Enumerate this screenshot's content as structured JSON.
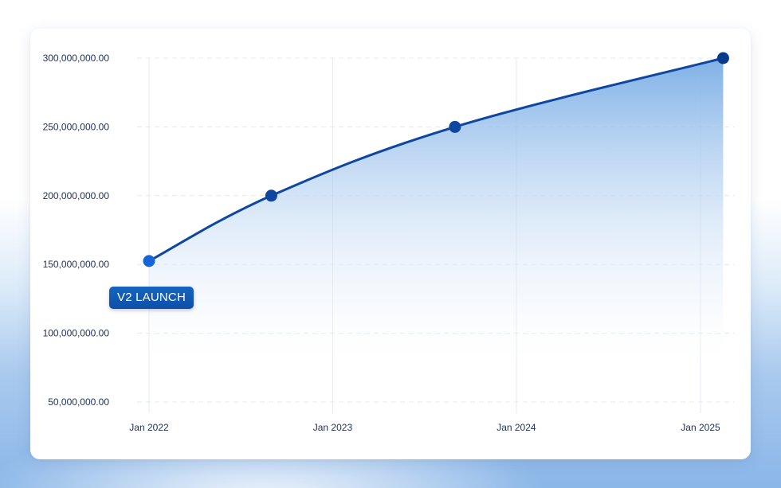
{
  "chart_data": {
    "type": "area",
    "x_type": "date",
    "x": [
      "2022-01-01",
      "2022-09-01",
      "2023-09-01",
      "2025-02-15"
    ],
    "values": [
      152500000,
      200000000,
      250000000,
      300000000
    ],
    "xlim": [
      "2021-11-15",
      "2025-02-15"
    ],
    "ylim": [
      50000000,
      300000000
    ],
    "yticks": [
      {
        "value": 300000000,
        "label": "300,000,000.00"
      },
      {
        "value": 250000000,
        "label": "250,000,000.00"
      },
      {
        "value": 200000000,
        "label": "200,000,000.00"
      },
      {
        "value": 150000000,
        "label": "150,000,000.00"
      },
      {
        "value": 100000000,
        "label": "100,000,000.00"
      },
      {
        "value": 50000000,
        "label": "50,000,000.00"
      }
    ],
    "xticks": [
      {
        "value": "2022-01-01",
        "label": "Jan 2022"
      },
      {
        "value": "2023-01-01",
        "label": "Jan 2023"
      },
      {
        "value": "2024-01-01",
        "label": "Jan 2024"
      },
      {
        "value": "2025-01-01",
        "label": "Jan 2025"
      }
    ],
    "annotation": {
      "text": "V2 LAUNCH",
      "x": "2022-01-01"
    },
    "title": "",
    "xlabel": "",
    "ylabel": "",
    "grid": true,
    "legend": "none",
    "colors": {
      "line": "#0d47a1",
      "marker_first": "#1565d8",
      "marker_last": "#0a3a8a",
      "area_top": "#7fb0e6",
      "area_bottom": "#ffffff",
      "grid": "#e3e9f1",
      "badge": "#1565c0"
    }
  }
}
